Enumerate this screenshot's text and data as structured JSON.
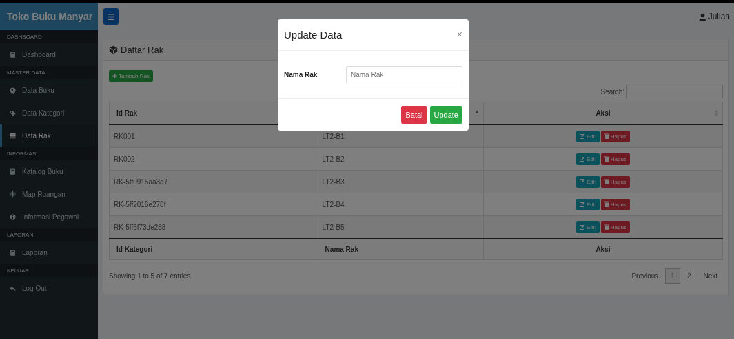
{
  "sidebar": {
    "brand": "Toko Buku Manyar",
    "sections": [
      {
        "header": "DASHBOARD",
        "items": [
          {
            "label": "Dashboard",
            "selected": false
          }
        ]
      },
      {
        "header": "MASTER DATA",
        "items": [
          {
            "label": "Data Buku",
            "selected": false
          },
          {
            "label": "Data Kategori",
            "selected": false
          },
          {
            "label": "Data Rak",
            "selected": true
          }
        ]
      },
      {
        "header": "INFORMASI",
        "items": [
          {
            "label": "Katalog Buku",
            "selected": false
          },
          {
            "label": "Map Ruangan",
            "selected": false
          },
          {
            "label": "Informasi Pegawai",
            "selected": false
          }
        ]
      },
      {
        "header": "LAPORAN",
        "items": [
          {
            "label": "Laporan",
            "selected": false
          }
        ]
      },
      {
        "header": "KELUAR",
        "items": [
          {
            "label": "Log Out",
            "selected": false
          }
        ]
      }
    ]
  },
  "topbar": {
    "user": "Julian"
  },
  "card": {
    "title": "Daftar Rak",
    "add_button": "Tambah Rak",
    "search_label": "Search:",
    "table": {
      "columns": [
        {
          "label": "Id Rak"
        },
        {
          "sorted": true
        },
        {
          "label": "Aksi",
          "sorted": false
        }
      ],
      "rows": [
        {
          "id": "RK001",
          "nama": "LT2-B1",
          "edit": "Edit",
          "delete": "Hapus"
        },
        {
          "id": "RK002",
          "nama": "LT2-B2",
          "edit": "Edit",
          "delete": "Hapus"
        },
        {
          "id": "RK-5ff0915aa3a7",
          "nama": "LT2-B3",
          "edit": "Edit",
          "delete": "Hapus"
        },
        {
          "id": "RK-5ff2016e278f",
          "nama": "LT2-B4",
          "edit": "Edit",
          "delete": "Hapus"
        },
        {
          "id": "RK-5ff6f73de288",
          "nama": "LT2-B5",
          "edit": "Edit",
          "delete": "Hapus"
        }
      ],
      "footer": [
        "Id Kategori",
        "Nama Rak",
        "Aksi"
      ]
    },
    "info": "Showing 1 to 5 of 7 entries",
    "pagination": {
      "previous": "Previous",
      "pages": [
        {
          "label": "1",
          "selected": true
        },
        {
          "label": "2",
          "selected": false
        }
      ],
      "next": "Next"
    }
  },
  "modal": {
    "title": "Update Data",
    "close": "×",
    "field_label": "Nama Rak",
    "placeholder": "Nama Rak",
    "cancel": "Batal",
    "submit": "Update"
  }
}
